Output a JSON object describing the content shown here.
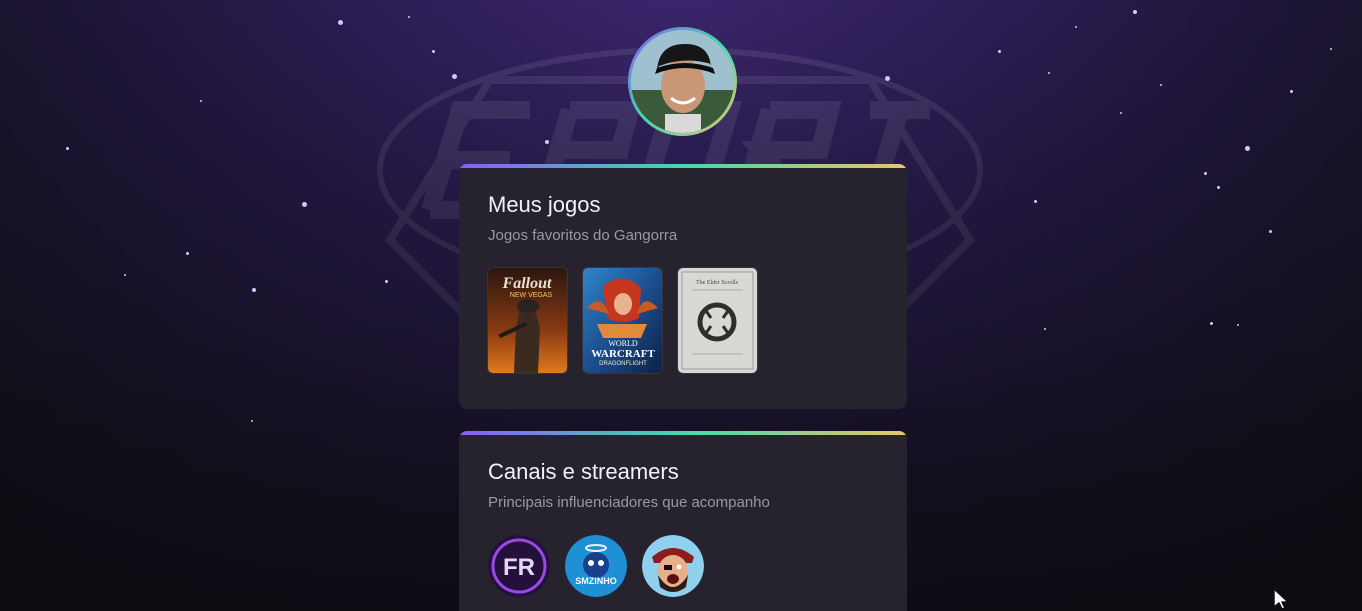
{
  "profile": {
    "avatar_icon": "user-avatar-photo"
  },
  "games_card": {
    "title": "Meus jogos",
    "subtitle": "Jogos favoritos do Gangorra",
    "games": [
      {
        "title_line1": "Fallout",
        "title_line2": "NEW VEGAS",
        "icon": "fallout-new-vegas-cover"
      },
      {
        "title_line1": "WORLD",
        "title_line2": "WARCRAFT",
        "title_line3": "DRAGONFLIGHT",
        "icon": "world-of-warcraft-dragonflight-cover"
      },
      {
        "title_line1": "The Elder Scrolls",
        "icon": "elder-scrolls-online-cover"
      }
    ]
  },
  "streamers_card": {
    "title": "Canais e streamers",
    "subtitle": "Principais influenciadores que acompanho",
    "streamers": [
      {
        "label": "FR",
        "icon": "streamer-avatar-fr"
      },
      {
        "label": "SMZINHO",
        "icon": "streamer-avatar-smzinho"
      },
      {
        "label": "",
        "icon": "streamer-avatar-pirate"
      }
    ]
  },
  "colors": {
    "accent_gradient": [
      "#8b5cf6",
      "#43d9ad",
      "#e9c46a"
    ],
    "card_bg": "#26232e"
  }
}
